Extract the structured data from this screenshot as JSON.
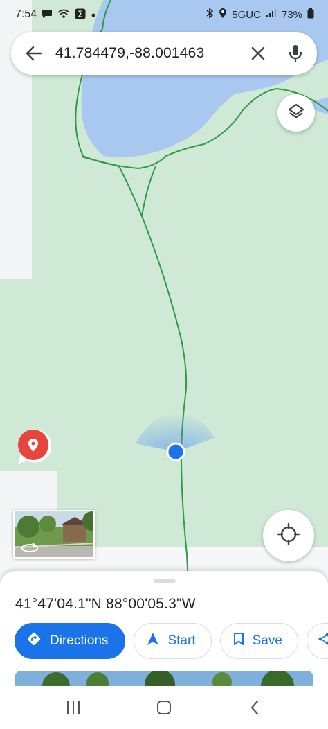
{
  "status_bar": {
    "time": "7:54",
    "network": "5GUC",
    "battery": "73%",
    "left_icons": [
      "chat-bubble-icon",
      "wifi-calling-icon",
      "sigma-app-icon",
      "dot-icon"
    ],
    "right_icons": [
      "bluetooth-icon",
      "location-icon",
      "signal-bars-icon",
      "battery-icon"
    ]
  },
  "search": {
    "query": "41.784479,-88.001463",
    "icons": [
      "back-arrow-icon",
      "close-icon",
      "mic-icon"
    ]
  },
  "map": {
    "colors": {
      "park": "#cfe9d6",
      "water": "#a9c8f0",
      "road": "#ffffff",
      "trail": "#2e9b46",
      "pin": "#e8453c",
      "location_dot": "#1a73e8"
    },
    "controls": [
      "layers-icon",
      "crosshair-locate-icon"
    ]
  },
  "place": {
    "coordinates": "41°47'04.1\"N 88°00'05.3\"W"
  },
  "actions": {
    "directions": "Directions",
    "start": "Start",
    "save": "Save",
    "icons": [
      "directions-diamond-icon",
      "navigation-arrow-icon",
      "bookmark-icon",
      "share-icon"
    ]
  },
  "navigation_bar": {
    "buttons": [
      "recent-apps-icon",
      "home-icon",
      "back-chevron-icon"
    ]
  }
}
